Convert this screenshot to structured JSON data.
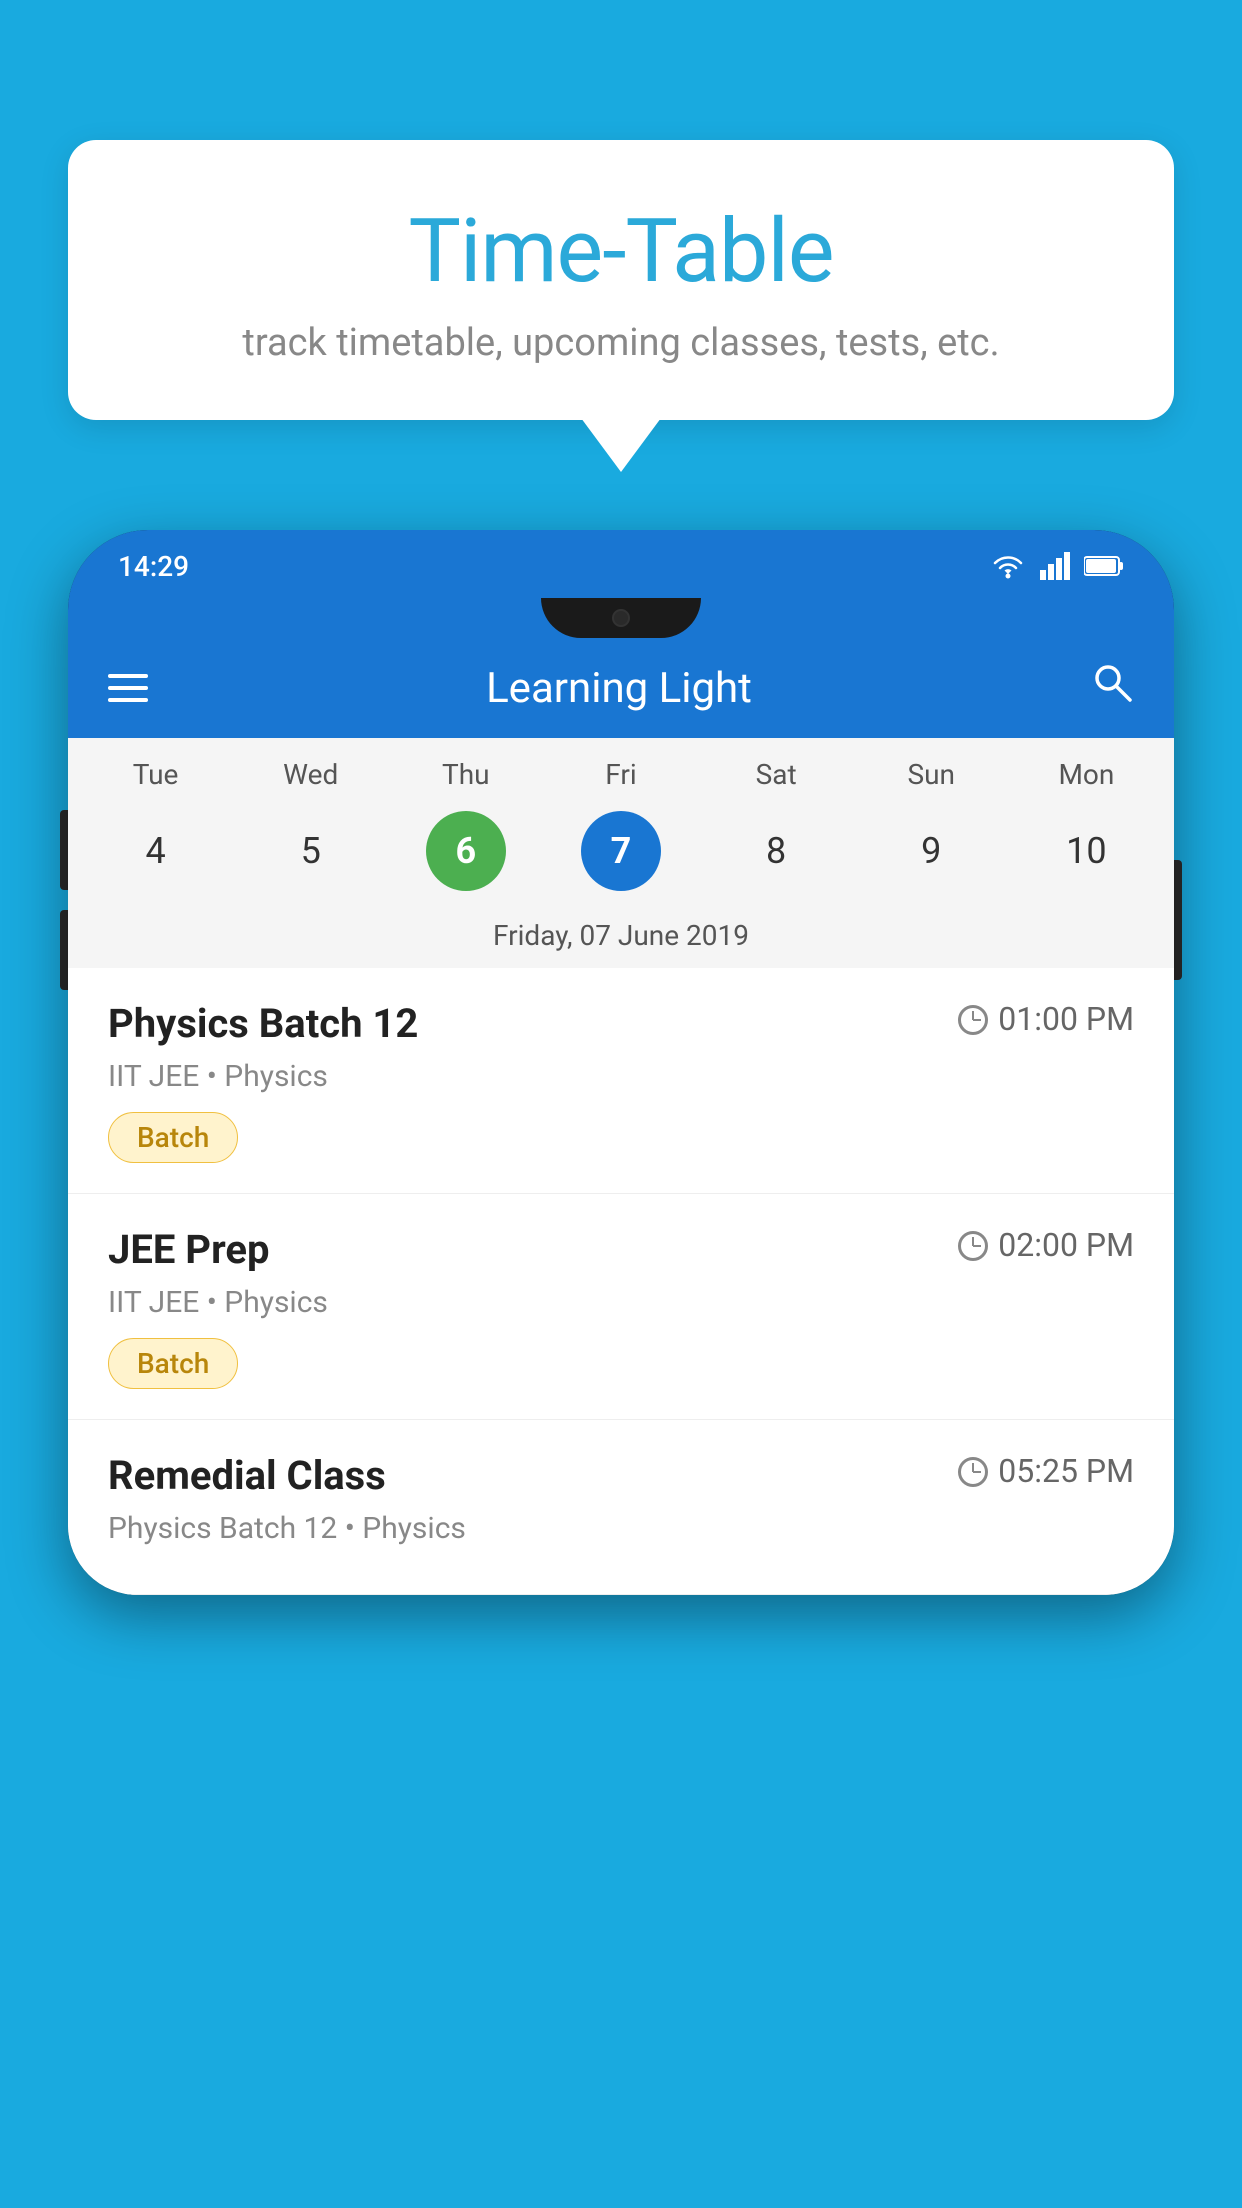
{
  "page": {
    "background_color": "#19AADF"
  },
  "speech_bubble": {
    "title": "Time-Table",
    "subtitle": "track timetable, upcoming classes, tests, etc."
  },
  "phone": {
    "status_bar": {
      "time": "14:29"
    },
    "app_bar": {
      "title": "Learning Light"
    },
    "calendar": {
      "days": [
        "Tue",
        "Wed",
        "Thu",
        "Fri",
        "Sat",
        "Sun",
        "Mon"
      ],
      "dates": [
        "4",
        "5",
        "6",
        "7",
        "8",
        "9",
        "10"
      ],
      "today_index": 2,
      "selected_index": 3,
      "selected_label": "Friday, 07 June 2019"
    },
    "classes": [
      {
        "name": "Physics Batch 12",
        "time": "01:00 PM",
        "subtitle": "IIT JEE • Physics",
        "badge": "Batch"
      },
      {
        "name": "JEE Prep",
        "time": "02:00 PM",
        "subtitle": "IIT JEE • Physics",
        "badge": "Batch"
      },
      {
        "name": "Remedial Class",
        "time": "05:25 PM",
        "subtitle": "Physics Batch 12 • Physics",
        "badge": null
      }
    ]
  }
}
